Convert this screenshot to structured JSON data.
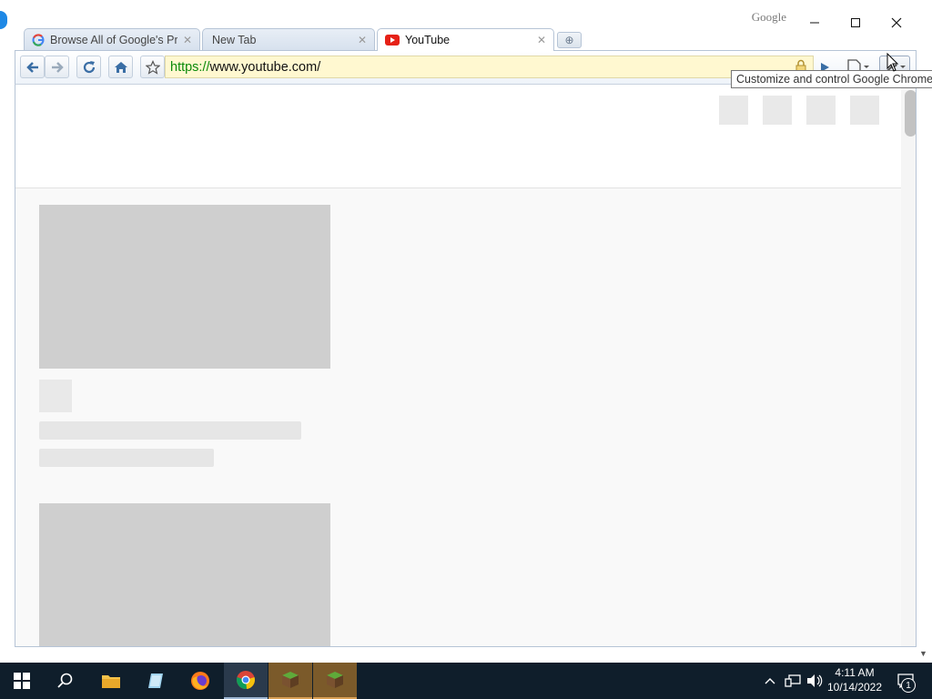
{
  "window": {
    "brand": "Google"
  },
  "tabs": [
    {
      "label": "Browse All of Google's Pr...",
      "favicon": "google-g-icon",
      "active": false
    },
    {
      "label": "New Tab",
      "favicon": "",
      "active": false
    },
    {
      "label": "YouTube",
      "favicon": "youtube-icon",
      "active": true
    }
  ],
  "omnibox": {
    "scheme": "https://",
    "host": "www.youtube.com/"
  },
  "tooltip": {
    "text": "Customize and control Google Chrome"
  },
  "taskbar": {
    "apps": [
      "start",
      "search",
      "file-explorer",
      "notepad",
      "firefox",
      "chrome",
      "minecraft",
      "minecraft"
    ],
    "clock": {
      "time": "4:11 AM",
      "date": "10/14/2022"
    },
    "notification_count": "1"
  },
  "colors": {
    "accent": "#0a8a0a",
    "omnibox_bg": "#fff8d0",
    "taskbar": "#0f1e2b"
  }
}
